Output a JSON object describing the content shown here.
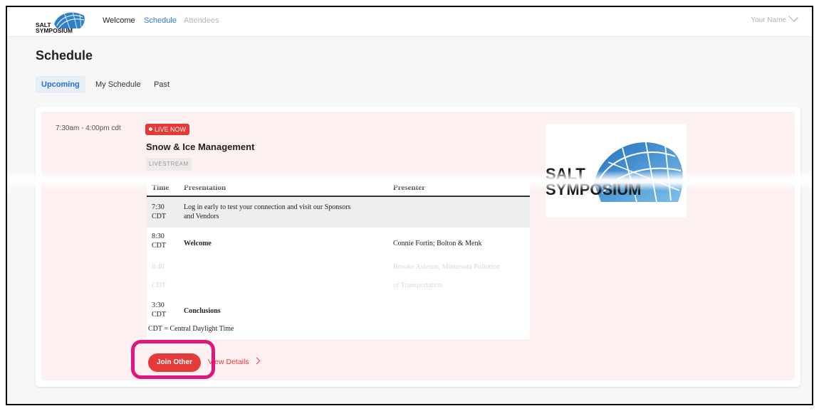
{
  "brand": {
    "logo_line1": "SALT",
    "logo_line2": "SYMPOSIUM"
  },
  "nav": {
    "welcome": "Welcome",
    "schedule": "Schedule",
    "attendees": "Attendees",
    "user_name": "Your Name"
  },
  "page": {
    "title": "Schedule"
  },
  "tabs": [
    "Upcoming",
    "My Schedule",
    "Past"
  ],
  "event": {
    "time_range": "7:30am - 4:00pm cdt",
    "live_badge": "LIVE NOW",
    "title": "Snow & Ice Management",
    "tag": "LIVESTREAM",
    "table": {
      "headers": [
        "Time",
        "Presentation",
        "Presenter"
      ],
      "rows": [
        {
          "time1": "7:30",
          "time2": "CDT",
          "presentation1": "Log in early to test your connection and visit our Sponsors",
          "presentation2": "and Vendors",
          "presenter1": "",
          "presenter2": ""
        },
        {
          "time1": "8:30",
          "time2": "CDT",
          "presentation1": "Welcome",
          "presentation2": "",
          "presenter1": "Connie Fortin; Bolton & Menk",
          "presenter2": ""
        },
        {
          "time1": "8:40",
          "time2": "CDT",
          "presentation1": "",
          "presentation2": "",
          "presenter1": "Brooke Asleson, Minnesota Pollution",
          "presenter2": "of Transportation"
        },
        {
          "time1": "3:30",
          "time2": "CDT",
          "presentation1": "Conclusions",
          "presentation2": "",
          "presenter1": "",
          "presenter2": ""
        }
      ],
      "footnote": "CDT = Central Daylight Time"
    },
    "join_label": "Join Other",
    "details_label": "View Details"
  },
  "colors": {
    "accent_blue": "#2a7bd3",
    "live_red": "#e53935",
    "highlight": "#e0157e",
    "card_bg": "#fdf0f0"
  }
}
